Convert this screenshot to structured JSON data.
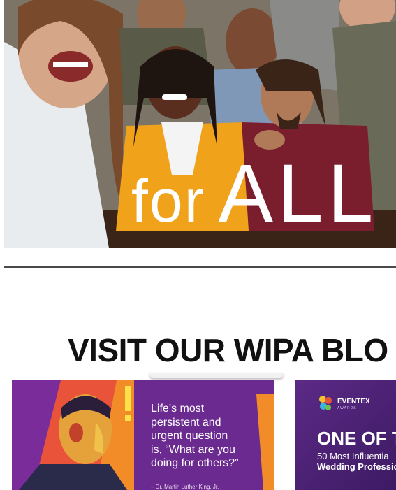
{
  "hero": {
    "word_for": "for",
    "word_all": "ALL"
  },
  "blog": {
    "title": "VISIT OUR WIPA BLO"
  },
  "card_quote": {
    "text": "Life’s most\npersistent and\nurgent question\nis, “What are you\ndoing for others?”",
    "attribution": "– Dr. Martin Luther King, Jr."
  },
  "card_eventex": {
    "brand": "EVENTEX",
    "brand_sub": "AWARDS",
    "headline": "ONE OF T",
    "line1": "50 Most Influentia",
    "line2": "Wedding Professio"
  },
  "colors": {
    "quote_bg": "#6b2a8f",
    "accent_orange": "#f28c28",
    "eventex_bg": "#4a1f73"
  }
}
